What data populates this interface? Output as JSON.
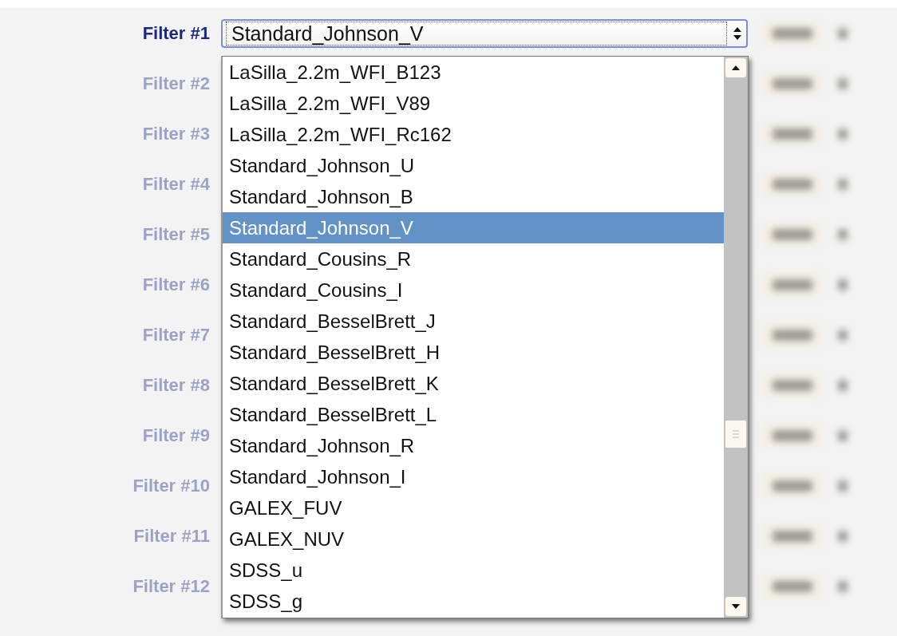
{
  "filters": [
    {
      "label": "Filter #1",
      "blurred": false,
      "value": "Standard_Johnson_V"
    },
    {
      "label": "Filter #2",
      "blurred": true
    },
    {
      "label": "Filter #3",
      "blurred": true
    },
    {
      "label": "Filter #4",
      "blurred": true
    },
    {
      "label": "Filter #5",
      "blurred": true
    },
    {
      "label": "Filter #6",
      "blurred": true
    },
    {
      "label": "Filter #7",
      "blurred": true
    },
    {
      "label": "Filter #8",
      "blurred": true
    },
    {
      "label": "Filter #9",
      "blurred": true
    },
    {
      "label": "Filter #10",
      "blurred": true
    },
    {
      "label": "Filter #11",
      "blurred": true
    },
    {
      "label": "Filter #12",
      "blurred": true
    }
  ],
  "dropdown": {
    "options": [
      {
        "label": "LaSilla_2.2m_WFI_B123",
        "selected": false
      },
      {
        "label": "LaSilla_2.2m_WFI_V89",
        "selected": false
      },
      {
        "label": "LaSilla_2.2m_WFI_Rc162",
        "selected": false
      },
      {
        "label": "Standard_Johnson_U",
        "selected": false
      },
      {
        "label": "Standard_Johnson_B",
        "selected": false
      },
      {
        "label": "Standard_Johnson_V",
        "selected": true
      },
      {
        "label": "Standard_Cousins_R",
        "selected": false
      },
      {
        "label": "Standard_Cousins_I",
        "selected": false
      },
      {
        "label": "Standard_BesselBrett_J",
        "selected": false
      },
      {
        "label": "Standard_BesselBrett_H",
        "selected": false
      },
      {
        "label": "Standard_BesselBrett_K",
        "selected": false
      },
      {
        "label": "Standard_BesselBrett_L",
        "selected": false
      },
      {
        "label": "Standard_Johnson_R",
        "selected": false
      },
      {
        "label": "Standard_Johnson_I",
        "selected": false
      },
      {
        "label": "GALEX_FUV",
        "selected": false
      },
      {
        "label": "GALEX_NUV",
        "selected": false
      },
      {
        "label": "SDSS_u",
        "selected": false
      },
      {
        "label": "SDSS_g",
        "selected": false
      }
    ]
  }
}
